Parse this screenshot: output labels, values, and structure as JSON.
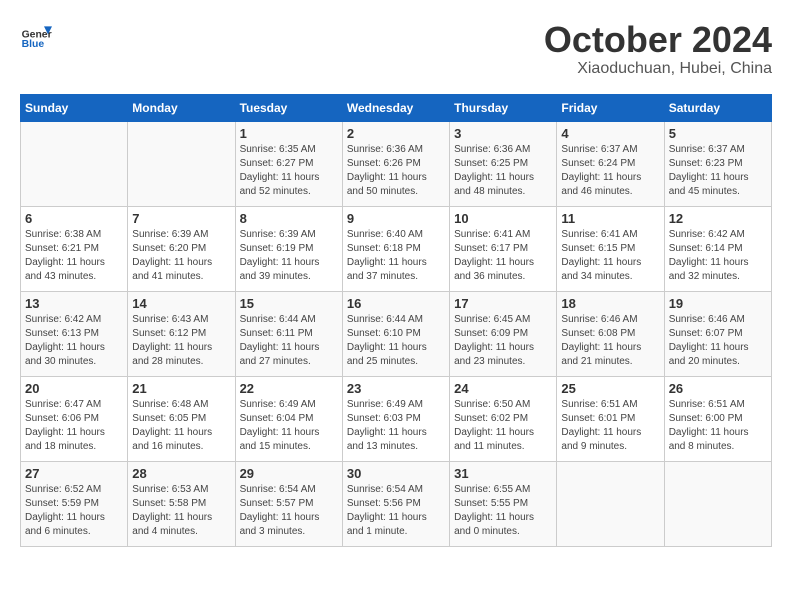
{
  "header": {
    "logo_line1": "General",
    "logo_line2": "Blue",
    "month": "October 2024",
    "location": "Xiaoduchuan, Hubei, China"
  },
  "days_of_week": [
    "Sunday",
    "Monday",
    "Tuesday",
    "Wednesday",
    "Thursday",
    "Friday",
    "Saturday"
  ],
  "weeks": [
    [
      {
        "day": "",
        "content": ""
      },
      {
        "day": "",
        "content": ""
      },
      {
        "day": "1",
        "content": "Sunrise: 6:35 AM\nSunset: 6:27 PM\nDaylight: 11 hours and 52 minutes."
      },
      {
        "day": "2",
        "content": "Sunrise: 6:36 AM\nSunset: 6:26 PM\nDaylight: 11 hours and 50 minutes."
      },
      {
        "day": "3",
        "content": "Sunrise: 6:36 AM\nSunset: 6:25 PM\nDaylight: 11 hours and 48 minutes."
      },
      {
        "day": "4",
        "content": "Sunrise: 6:37 AM\nSunset: 6:24 PM\nDaylight: 11 hours and 46 minutes."
      },
      {
        "day": "5",
        "content": "Sunrise: 6:37 AM\nSunset: 6:23 PM\nDaylight: 11 hours and 45 minutes."
      }
    ],
    [
      {
        "day": "6",
        "content": "Sunrise: 6:38 AM\nSunset: 6:21 PM\nDaylight: 11 hours and 43 minutes."
      },
      {
        "day": "7",
        "content": "Sunrise: 6:39 AM\nSunset: 6:20 PM\nDaylight: 11 hours and 41 minutes."
      },
      {
        "day": "8",
        "content": "Sunrise: 6:39 AM\nSunset: 6:19 PM\nDaylight: 11 hours and 39 minutes."
      },
      {
        "day": "9",
        "content": "Sunrise: 6:40 AM\nSunset: 6:18 PM\nDaylight: 11 hours and 37 minutes."
      },
      {
        "day": "10",
        "content": "Sunrise: 6:41 AM\nSunset: 6:17 PM\nDaylight: 11 hours and 36 minutes."
      },
      {
        "day": "11",
        "content": "Sunrise: 6:41 AM\nSunset: 6:15 PM\nDaylight: 11 hours and 34 minutes."
      },
      {
        "day": "12",
        "content": "Sunrise: 6:42 AM\nSunset: 6:14 PM\nDaylight: 11 hours and 32 minutes."
      }
    ],
    [
      {
        "day": "13",
        "content": "Sunrise: 6:42 AM\nSunset: 6:13 PM\nDaylight: 11 hours and 30 minutes."
      },
      {
        "day": "14",
        "content": "Sunrise: 6:43 AM\nSunset: 6:12 PM\nDaylight: 11 hours and 28 minutes."
      },
      {
        "day": "15",
        "content": "Sunrise: 6:44 AM\nSunset: 6:11 PM\nDaylight: 11 hours and 27 minutes."
      },
      {
        "day": "16",
        "content": "Sunrise: 6:44 AM\nSunset: 6:10 PM\nDaylight: 11 hours and 25 minutes."
      },
      {
        "day": "17",
        "content": "Sunrise: 6:45 AM\nSunset: 6:09 PM\nDaylight: 11 hours and 23 minutes."
      },
      {
        "day": "18",
        "content": "Sunrise: 6:46 AM\nSunset: 6:08 PM\nDaylight: 11 hours and 21 minutes."
      },
      {
        "day": "19",
        "content": "Sunrise: 6:46 AM\nSunset: 6:07 PM\nDaylight: 11 hours and 20 minutes."
      }
    ],
    [
      {
        "day": "20",
        "content": "Sunrise: 6:47 AM\nSunset: 6:06 PM\nDaylight: 11 hours and 18 minutes."
      },
      {
        "day": "21",
        "content": "Sunrise: 6:48 AM\nSunset: 6:05 PM\nDaylight: 11 hours and 16 minutes."
      },
      {
        "day": "22",
        "content": "Sunrise: 6:49 AM\nSunset: 6:04 PM\nDaylight: 11 hours and 15 minutes."
      },
      {
        "day": "23",
        "content": "Sunrise: 6:49 AM\nSunset: 6:03 PM\nDaylight: 11 hours and 13 minutes."
      },
      {
        "day": "24",
        "content": "Sunrise: 6:50 AM\nSunset: 6:02 PM\nDaylight: 11 hours and 11 minutes."
      },
      {
        "day": "25",
        "content": "Sunrise: 6:51 AM\nSunset: 6:01 PM\nDaylight: 11 hours and 9 minutes."
      },
      {
        "day": "26",
        "content": "Sunrise: 6:51 AM\nSunset: 6:00 PM\nDaylight: 11 hours and 8 minutes."
      }
    ],
    [
      {
        "day": "27",
        "content": "Sunrise: 6:52 AM\nSunset: 5:59 PM\nDaylight: 11 hours and 6 minutes."
      },
      {
        "day": "28",
        "content": "Sunrise: 6:53 AM\nSunset: 5:58 PM\nDaylight: 11 hours and 4 minutes."
      },
      {
        "day": "29",
        "content": "Sunrise: 6:54 AM\nSunset: 5:57 PM\nDaylight: 11 hours and 3 minutes."
      },
      {
        "day": "30",
        "content": "Sunrise: 6:54 AM\nSunset: 5:56 PM\nDaylight: 11 hours and 1 minute."
      },
      {
        "day": "31",
        "content": "Sunrise: 6:55 AM\nSunset: 5:55 PM\nDaylight: 11 hours and 0 minutes."
      },
      {
        "day": "",
        "content": ""
      },
      {
        "day": "",
        "content": ""
      }
    ]
  ]
}
